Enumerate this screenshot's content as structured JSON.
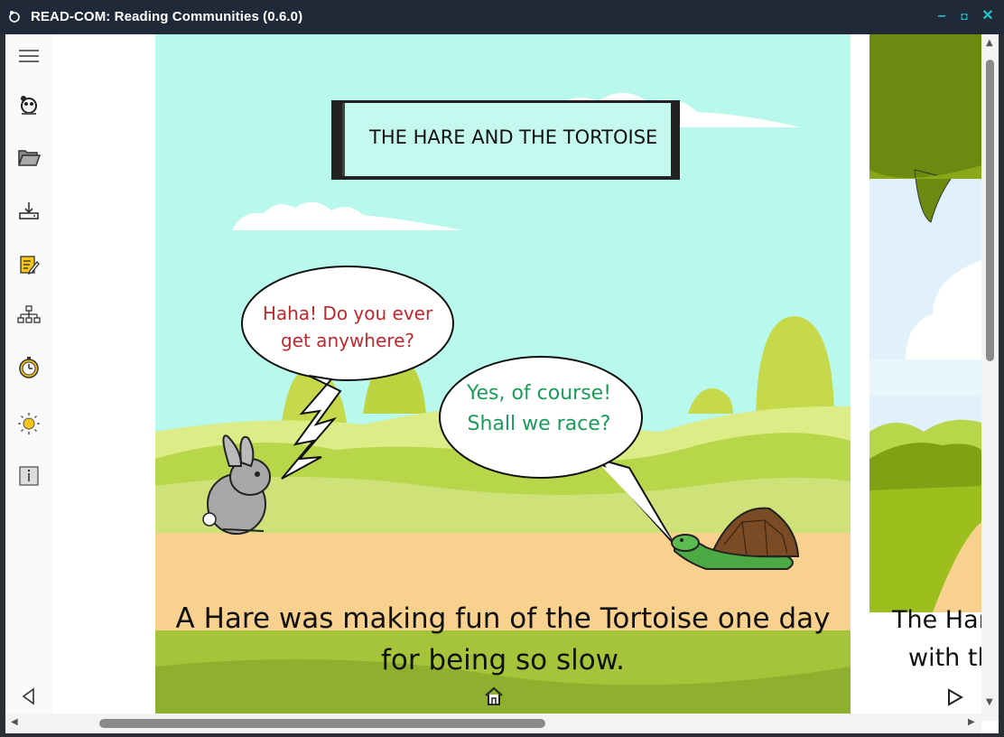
{
  "window": {
    "title": "READ-COM: Reading Communities (0.6.0)",
    "minimize": "–",
    "maximize": "◘",
    "close": "✕"
  },
  "sidebar": {
    "items": [
      {
        "icon": "hamburger-menu-icon"
      },
      {
        "icon": "read-com-logo-icon"
      },
      {
        "icon": "folder-open-icon"
      },
      {
        "icon": "download-icon"
      },
      {
        "icon": "edit-notes-icon"
      },
      {
        "icon": "hierarchy-icon"
      },
      {
        "icon": "timer-icon"
      },
      {
        "icon": "sun-brightness-icon"
      },
      {
        "icon": "info-icon"
      },
      {
        "icon": "previous-page-icon"
      }
    ]
  },
  "story": {
    "title": "THE HARE AND THE TORTOISE",
    "hare_speech_line1": "Haha! Do you ever",
    "hare_speech_line2": "get anywhere?",
    "tortoise_speech_line1": "Yes, of course!",
    "tortoise_speech_line2": "Shall we race?",
    "caption_line1": "A Hare was making fun of the Tortoise one day",
    "caption_line2": "for being so slow.",
    "next_caption_line1": "The Har",
    "next_caption_line2": "with th"
  },
  "colors": {
    "titlebar": "#1f2937",
    "window_buttons": "#22c5c8",
    "sky": "#b9f8ec",
    "ground": "#f9d18f",
    "hare_speech": "#c0282d",
    "tortoise_speech": "#1a9c5a"
  }
}
